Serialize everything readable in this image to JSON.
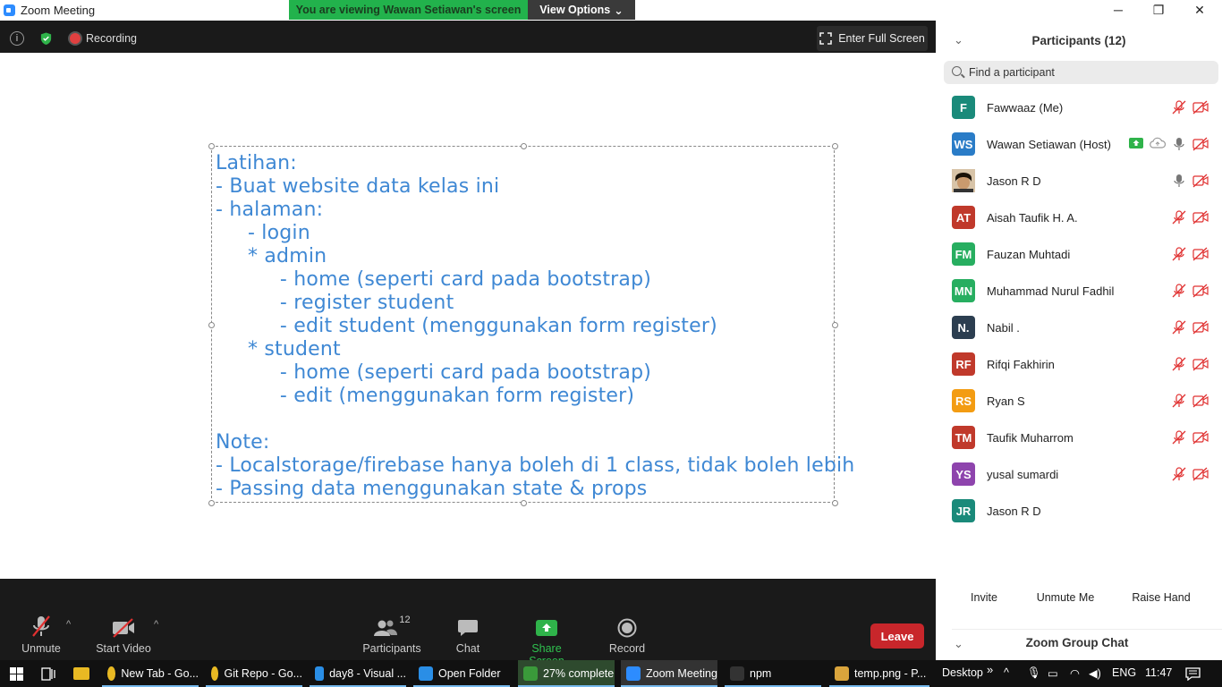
{
  "window": {
    "title": "Zoom Meeting",
    "viewing_banner": "You are viewing Wawan Setiawan's screen",
    "view_options": "View Options",
    "controls": [
      "minimize-icon",
      "restore-icon",
      "close-icon"
    ]
  },
  "topbar": {
    "recording": "Recording",
    "fullscreen": "Enter Full Screen"
  },
  "slide": {
    "lines": [
      "Latihan:",
      "- Buat website data kelas ini",
      "- halaman:",
      "     - login",
      "     * admin",
      "          - home (seperti card pada bootstrap)",
      "          - register student",
      "          - edit student (menggunakan form register)",
      "     * student",
      "          - home (seperti card pada bootstrap)",
      "          - edit (menggunakan form register)",
      "",
      "Note:",
      "- Localstorage/firebase hanya boleh di 1 class, tidak boleh lebih",
      "- Passing data menggunakan state & props"
    ]
  },
  "toolbar": {
    "unmute": "Unmute",
    "start_video": "Start Video",
    "participants": "Participants",
    "participants_count": "12",
    "chat": "Chat",
    "share_screen": "Share Screen",
    "record": "Record",
    "leave": "Leave"
  },
  "panel": {
    "title": "Participants (12)",
    "search_placeholder": "Find a participant",
    "participants": [
      {
        "initials": "F",
        "name": "Fawwaaz (Me)",
        "color": "#1a8a7a",
        "muted": true,
        "video_off": true
      },
      {
        "initials": "WS",
        "name": "Wawan Setiawan (Host)",
        "color": "#2a7cc7",
        "muted": false,
        "video_off": true,
        "sharing": true
      },
      {
        "initials": "",
        "name": "Jason R D",
        "color": "#6b4a2a",
        "muted": false,
        "video_off": true,
        "photo": true
      },
      {
        "initials": "AT",
        "name": "Aisah Taufik H. A.",
        "color": "#c0392b",
        "muted": true,
        "video_off": true
      },
      {
        "initials": "FM",
        "name": "Fauzan Muhtadi",
        "color": "#27ae60",
        "muted": true,
        "video_off": true
      },
      {
        "initials": "MN",
        "name": "Muhammad Nurul Fadhil",
        "color": "#27ae60",
        "muted": true,
        "video_off": true
      },
      {
        "initials": "N.",
        "name": "Nabil .",
        "color": "#2c3e50",
        "muted": true,
        "video_off": true
      },
      {
        "initials": "RF",
        "name": "Rifqi Fakhirin",
        "color": "#c0392b",
        "muted": true,
        "video_off": true
      },
      {
        "initials": "RS",
        "name": "Ryan S",
        "color": "#f39c12",
        "muted": true,
        "video_off": true
      },
      {
        "initials": "TM",
        "name": "Taufik Muharrom",
        "color": "#c0392b",
        "muted": true,
        "video_off": true
      },
      {
        "initials": "YS",
        "name": "yusal sumardi",
        "color": "#8e44ad",
        "muted": true,
        "video_off": true
      },
      {
        "initials": "JR",
        "name": "Jason R D",
        "color": "#1a8a7a",
        "muted": false,
        "video_off": false
      }
    ],
    "buttons": [
      "Invite",
      "Unmute Me",
      "Raise Hand"
    ],
    "chat_title": "Zoom Group Chat"
  },
  "taskbar": {
    "tasks": [
      {
        "label": "New Tab - Go...",
        "icon": "chrome-icon",
        "color": "#e8b923"
      },
      {
        "label": "Git Repo - Go...",
        "icon": "chrome-icon",
        "color": "#e8b923"
      },
      {
        "label": "day8 - Visual ...",
        "icon": "vscode-icon",
        "color": "#2a8ee6"
      },
      {
        "label": "Open Folder",
        "icon": "vscode-icon",
        "color": "#2a8ee6"
      },
      {
        "label": "27% complete",
        "icon": "download-icon",
        "color": "#3a9a3a"
      },
      {
        "label": "Zoom Meeting",
        "icon": "zoom-icon",
        "color": "#2d8cff"
      },
      {
        "label": "npm",
        "icon": "cmd-icon",
        "color": "#333333"
      },
      {
        "label": "temp.png - P...",
        "icon": "paint-icon",
        "color": "#d9a43c"
      }
    ],
    "desktop": "Desktop",
    "lang": "ENG",
    "time": "11:47"
  }
}
